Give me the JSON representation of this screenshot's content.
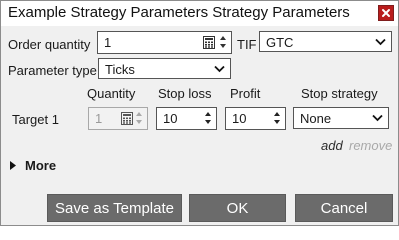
{
  "window": {
    "title": "Example Strategy Parameters Strategy Parameters"
  },
  "order": {
    "quantity_label": "Order quantity",
    "quantity_value": "1",
    "tif_label": "TIF",
    "tif_value": "GTC"
  },
  "parameter_type": {
    "label": "Parameter type",
    "value": "Ticks"
  },
  "targets": {
    "headers": {
      "quantity": "Quantity",
      "stop_loss": "Stop loss",
      "profit": "Profit",
      "stop_strategy": "Stop strategy"
    },
    "rows": [
      {
        "label": "Target 1",
        "quantity": "1",
        "stop_loss": "10",
        "profit": "10",
        "stop_strategy": "None"
      }
    ],
    "add_label": "add",
    "remove_label": "remove"
  },
  "more": {
    "label": "More"
  },
  "buttons": {
    "save_template": "Save as Template",
    "ok": "OK",
    "cancel": "Cancel"
  },
  "colors": {
    "close_red": "#b91c1c",
    "button_gray": "#6b6b6b"
  },
  "icons": {
    "close": "close-icon",
    "calculator": "calculator-icon",
    "spinner": "spinner-icon",
    "dropdown": "chevron-down-icon",
    "expand": "triangle-right-icon"
  }
}
